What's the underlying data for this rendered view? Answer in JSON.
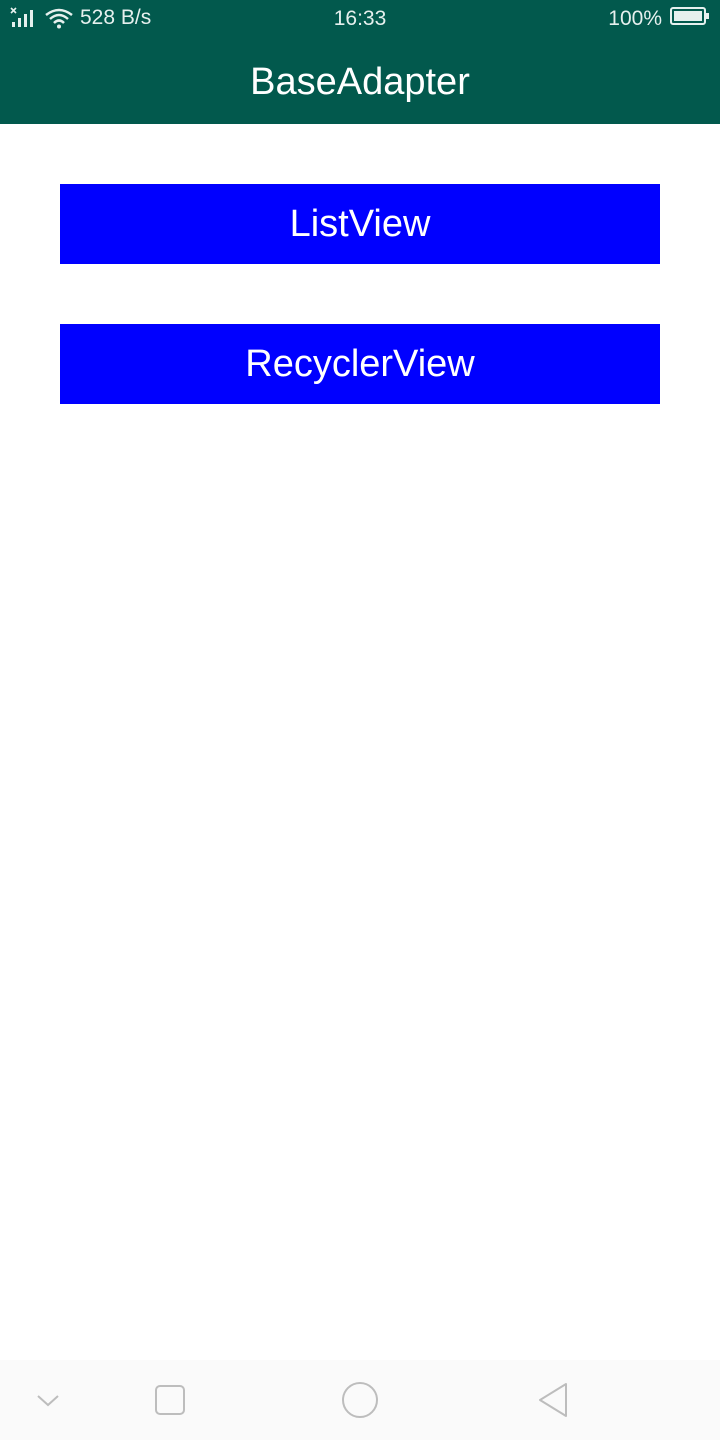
{
  "status_bar": {
    "network_speed": "528 B/s",
    "time": "16:33",
    "battery": "100%",
    "icons": [
      "cellular-no-sim-icon",
      "wifi-icon",
      "battery-icon"
    ]
  },
  "app_bar": {
    "title": "BaseAdapter"
  },
  "main": {
    "buttons": [
      {
        "label": "ListView"
      },
      {
        "label": "RecyclerView"
      }
    ]
  },
  "nav_bar": {
    "icons": [
      "chevron-down-icon",
      "recents-square-icon",
      "home-circle-icon",
      "back-triangle-icon"
    ]
  },
  "colors": {
    "primary_dark": "#02594d",
    "button_bg": "#0000ff",
    "button_text": "#ffffff",
    "nav_bar_bg": "#fafafa"
  }
}
